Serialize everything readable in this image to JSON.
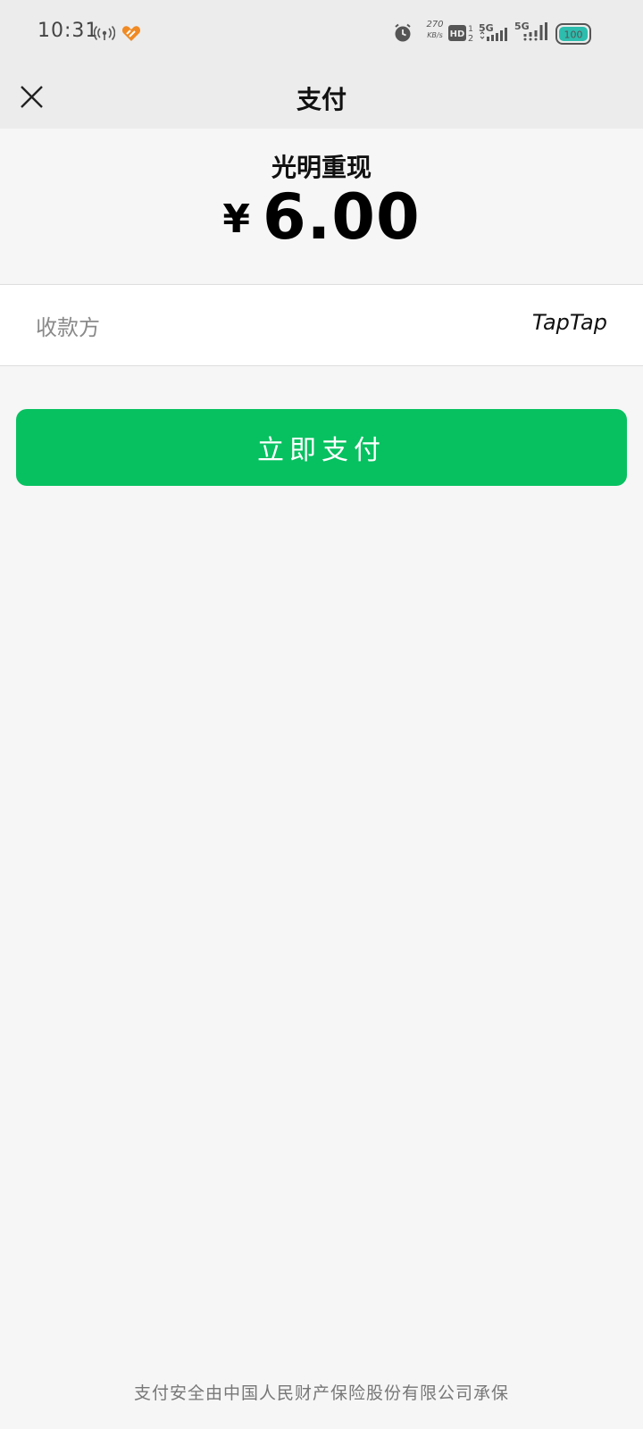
{
  "status_bar": {
    "time": "10:31",
    "net_speed": "270",
    "net_speed_unit": "KB/s",
    "hd_sup": "1",
    "hd_sub": "2",
    "sim1_type": "5G",
    "sim2_type": "5G",
    "battery": "100",
    "accent_color": "#f08a24",
    "battery_color": "#2dbdae"
  },
  "nav": {
    "title": "支付",
    "close_icon": "close-icon"
  },
  "order": {
    "product_name": "光明重现",
    "currency_symbol": "¥",
    "amount": "6.00"
  },
  "payee": {
    "label": "收款方",
    "value": "TapTap"
  },
  "pay_button": {
    "label": "立即支付",
    "color": "#07c160"
  },
  "footer": {
    "note": "支付安全由中国人民财产保险股份有限公司承保"
  }
}
